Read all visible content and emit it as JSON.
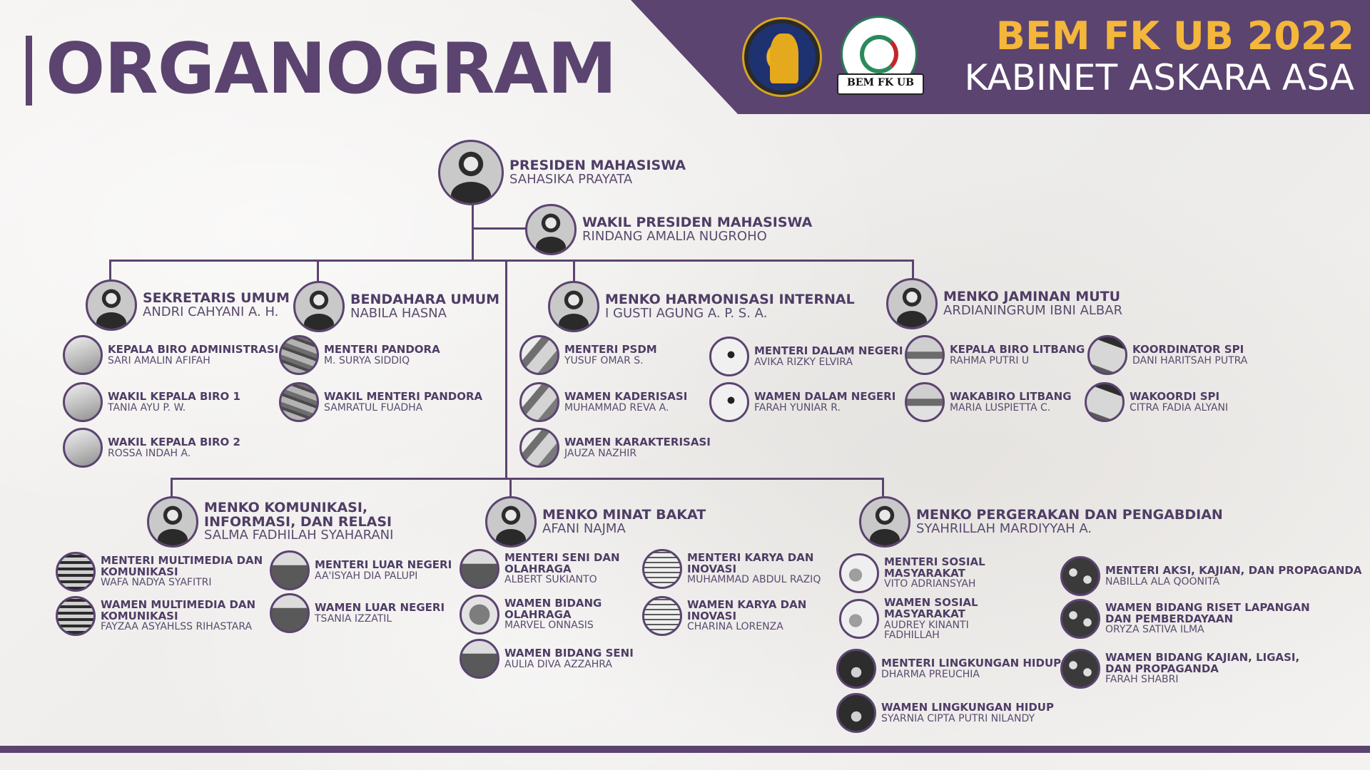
{
  "header": {
    "title": "ORGANOGRAM",
    "brand_line1": "BEM FK UB 2022",
    "brand_line2": "KABINET ASKARA ASA",
    "logo2_text": "BEM FK UB",
    "accent_color": "#5b4470",
    "brand_color": "#f4b73c"
  },
  "top": {
    "president": {
      "role": "PRESIDEN MAHASISWA",
      "name": "SAHASIKA PRAYATA"
    },
    "vice": {
      "role": "WAKIL PRESIDEN MAHASISWA",
      "name": "RINDANG AMALIA NUGROHO"
    }
  },
  "row1": {
    "sekum": {
      "role": "SEKRETARIS UMUM",
      "name": "ANDRI CAHYANI A. H."
    },
    "bendum": {
      "role": "BENDAHARA UMUM",
      "name": "NABILA HASNA"
    },
    "hi": {
      "role": "MENKO HARMONISASI INTERNAL",
      "name": "I GUSTI AGUNG A. P. S. A."
    },
    "jm": {
      "role": "MENKO JAMINAN MUTU",
      "name": "ARDIANINGRUM IBNI ALBAR"
    }
  },
  "row1_members": [
    {
      "role": "KEPALA BIRO ADMINISTRASI",
      "name": "SARI AMALIN AFIFAH"
    },
    {
      "role": "WAKIL KEPALA BIRO 1",
      "name": "TANIA AYU P. W."
    },
    {
      "role": "WAKIL KEPALA BIRO 2",
      "name": "ROSSA INDAH A."
    },
    {
      "role": "MENTERI PANDORA",
      "name": "M. SURYA SIDDIQ"
    },
    {
      "role": "WAKIL MENTERI PANDORA",
      "name": "SAMRATUL FUADHA"
    },
    {
      "role": "MENTERI PSDM",
      "name": "YUSUF OMAR S."
    },
    {
      "role": "WAMEN KADERISASI",
      "name": "MUHAMMAD REVA A."
    },
    {
      "role": "WAMEN KARAKTERISASI",
      "name": "JAUZA NAZHIR"
    },
    {
      "role": "MENTERI DALAM NEGERI",
      "name": "AVIKA RIZKY ELVIRA"
    },
    {
      "role": "WAMEN DALAM NEGERI",
      "name": "FARAH YUNIAR R."
    },
    {
      "role": "KEPALA BIRO LITBANG",
      "name": "RAHMA PUTRI U"
    },
    {
      "role": "WAKABIRO LITBANG",
      "name": "MARIA LUSPIETTA C."
    },
    {
      "role": "KOORDINATOR SPI",
      "name": "DANI HARITSAH PUTRA"
    },
    {
      "role": "WAKOORDI SPI",
      "name": "CITRA FADIA ALYANI"
    }
  ],
  "row2": {
    "kir": {
      "role": "MENKO KOMUNIKASI, INFORMASI, DAN RELASI",
      "name": "SALMA FADHILAH SYAHARANI"
    },
    "mb": {
      "role": "MENKO MINAT BAKAT",
      "name": "AFANI NAJMA"
    },
    "pp": {
      "role": "MENKO PERGERAKAN DAN PENGABDIAN",
      "name": "SYAHRILLAH MARDIYYAH A."
    }
  },
  "row2_members": [
    {
      "role": "MENTERI MULTIMEDIA DAN KOMUNIKASI",
      "name": "WAFA NADYA SYAFITRI"
    },
    {
      "role": "WAMEN MULTIMEDIA DAN KOMUNIKASI",
      "name": "FAYZAA ASYAHLSS RIHASTARA"
    },
    {
      "role": "MENTERI LUAR NEGERI",
      "name": "AA'ISYAH DIA PALUPI"
    },
    {
      "role": "WAMEN LUAR NEGERI",
      "name": "TSANIA IZZATIL"
    },
    {
      "role": "MENTERI SENI DAN OLAHRAGA",
      "name": "ALBERT SUKIANTO"
    },
    {
      "role": "WAMEN BIDANG OLAHRAGA",
      "name": "MARVEL ONNASIS"
    },
    {
      "role": "WAMEN BIDANG SENI",
      "name": "AULIA DIVA AZZAHRA"
    },
    {
      "role": "MENTERI KARYA DAN INOVASI",
      "name": "MUHAMMAD ABDUL RAZIQ"
    },
    {
      "role": "WAMEN KARYA DAN INOVASI",
      "name": "CHARINA LORENZA"
    },
    {
      "role": "MENTERI SOSIAL MASYARAKAT",
      "name": "VITO ADRIANSYAH"
    },
    {
      "role": "WAMEN SOSIAL MASYARAKAT",
      "name": "AUDREY KINANTI FADHILLAH"
    },
    {
      "role": "MENTERI LINGKUNGAN HIDUP",
      "name": "DHARMA PREUCHIA"
    },
    {
      "role": "WAMEN LINGKUNGAN HIDUP",
      "name": "SYARNIA CIPTA PUTRI NILANDY"
    },
    {
      "role": "MENTERI AKSI, KAJIAN, DAN PROPAGANDA",
      "name": "NABILLA ALA QOONITA"
    },
    {
      "role": "WAMEN BIDANG RISET LAPANGAN DAN PEMBERDAYAAN",
      "name": "ORYZA SATIVA ILMA"
    },
    {
      "role": "WAMEN BIDANG KAJIAN, LIGASI, DAN PROPAGANDA",
      "name": "FARAH SHABRI"
    }
  ]
}
